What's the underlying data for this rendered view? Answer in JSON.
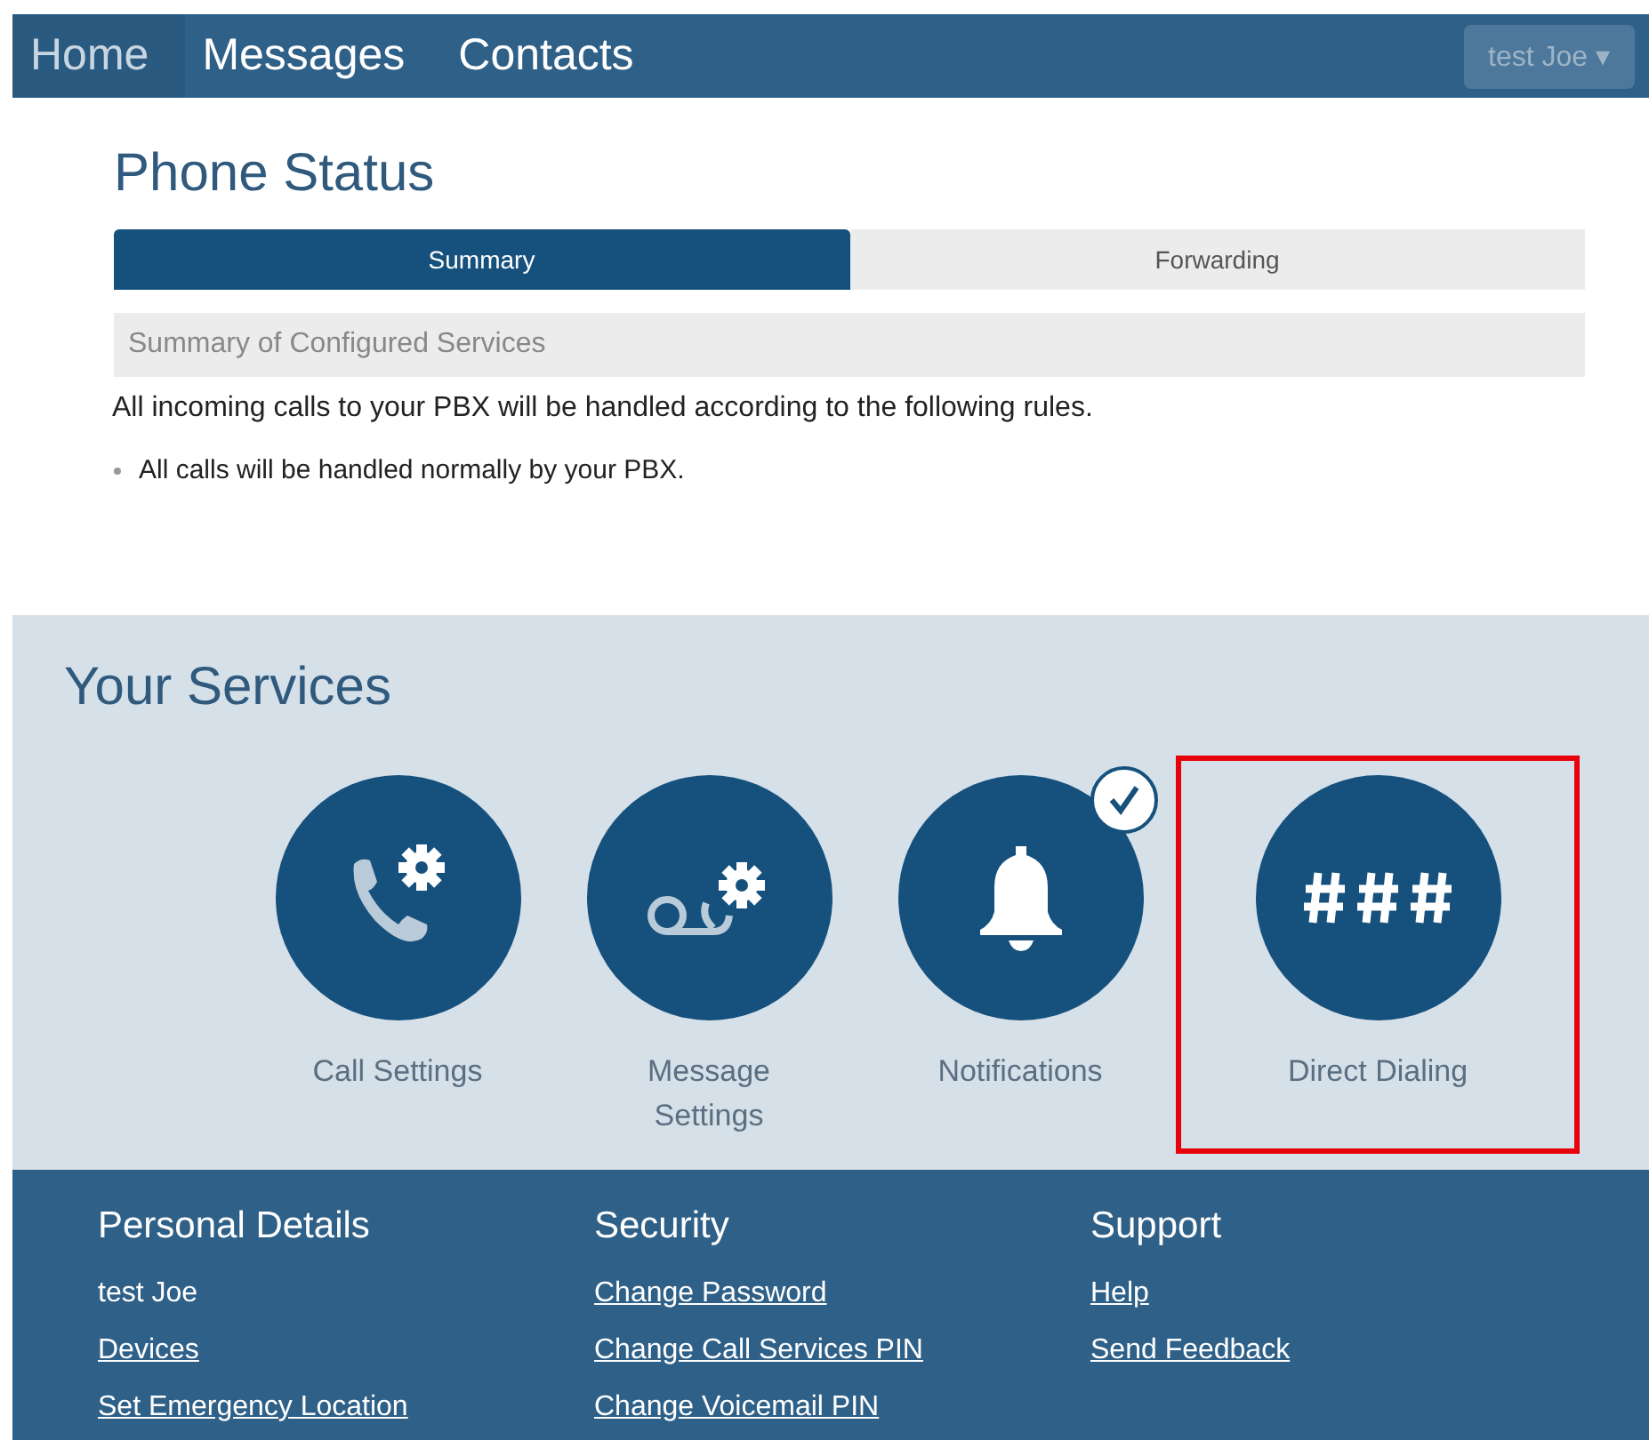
{
  "nav": {
    "items": [
      {
        "label": "Home",
        "selected": true
      },
      {
        "label": "Messages",
        "selected": false
      },
      {
        "label": "Contacts",
        "selected": false
      }
    ],
    "user_menu": {
      "label": "test Joe",
      "caret": "▾"
    }
  },
  "phone_status": {
    "title": "Phone Status",
    "tabs": [
      {
        "label": "Summary",
        "selected": true
      },
      {
        "label": "Forwarding",
        "selected": false
      }
    ],
    "panel_title": "Summary of Configured Services",
    "intro": "All incoming calls to your PBX will be handled according to the following rules.",
    "rules": [
      "All calls will be handled normally by your PBX."
    ]
  },
  "services": {
    "title": "Your Services",
    "items": [
      {
        "kind": "call",
        "label": "Call Settings",
        "checked": false,
        "highlighted": false
      },
      {
        "kind": "voicemail",
        "label": "Message Settings",
        "checked": false,
        "highlighted": false
      },
      {
        "kind": "bell",
        "label": "Notifications",
        "checked": true,
        "highlighted": false
      },
      {
        "kind": "hash",
        "label": "Direct Dialing",
        "checked": false,
        "highlighted": true
      }
    ]
  },
  "footer": {
    "columns": [
      {
        "title": "Personal Details",
        "items": [
          {
            "kind": "text",
            "label": "test Joe"
          },
          {
            "kind": "link",
            "label": "Devices"
          },
          {
            "kind": "link",
            "label": "Set Emergency Location"
          }
        ]
      },
      {
        "title": "Security",
        "items": [
          {
            "kind": "link",
            "label": "Change Password"
          },
          {
            "kind": "link",
            "label": "Change Call Services PIN"
          },
          {
            "kind": "link",
            "label": "Change Voicemail PIN"
          }
        ]
      },
      {
        "title": "Support",
        "items": [
          {
            "kind": "link",
            "label": "Help"
          },
          {
            "kind": "link",
            "label": "Send Feedback"
          }
        ]
      }
    ]
  }
}
